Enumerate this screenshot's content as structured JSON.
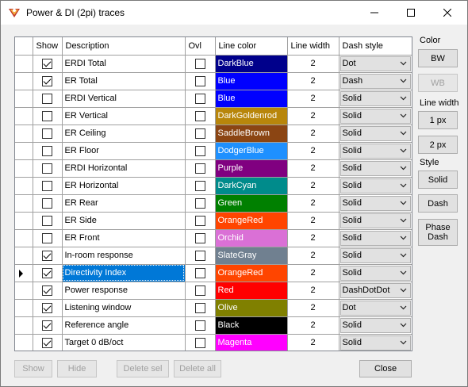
{
  "window": {
    "title": "Power & DI (2pi) traces"
  },
  "columns": {
    "show": "Show",
    "description": "Description",
    "ovl": "Ovl",
    "line_color": "Line color",
    "line_width": "Line width",
    "dash_style": "Dash style"
  },
  "rows": [
    {
      "show": true,
      "description": "ERDI Total",
      "ovl": false,
      "color_name": "DarkBlue",
      "color_hex": "#00008b",
      "width": "2",
      "dash": "Dot"
    },
    {
      "show": true,
      "description": "ER Total",
      "ovl": false,
      "color_name": "Blue",
      "color_hex": "#0000ff",
      "width": "2",
      "dash": "Dash"
    },
    {
      "show": false,
      "description": "ERDI Vertical",
      "ovl": false,
      "color_name": "Blue",
      "color_hex": "#0000ff",
      "width": "2",
      "dash": "Solid"
    },
    {
      "show": false,
      "description": "ER Vertical",
      "ovl": false,
      "color_name": "DarkGoldenrod",
      "color_hex": "#b8860b",
      "width": "2",
      "dash": "Solid"
    },
    {
      "show": false,
      "description": "ER Ceiling",
      "ovl": false,
      "color_name": "SaddleBrown",
      "color_hex": "#8b4513",
      "width": "2",
      "dash": "Solid"
    },
    {
      "show": false,
      "description": "ER Floor",
      "ovl": false,
      "color_name": "DodgerBlue",
      "color_hex": "#1e90ff",
      "width": "2",
      "dash": "Solid"
    },
    {
      "show": false,
      "description": "ERDI Horizontal",
      "ovl": false,
      "color_name": "Purple",
      "color_hex": "#800080",
      "width": "2",
      "dash": "Solid"
    },
    {
      "show": false,
      "description": "ER Horizontal",
      "ovl": false,
      "color_name": "DarkCyan",
      "color_hex": "#008b8b",
      "width": "2",
      "dash": "Solid"
    },
    {
      "show": false,
      "description": "ER Rear",
      "ovl": false,
      "color_name": "Green",
      "color_hex": "#008000",
      "width": "2",
      "dash": "Solid"
    },
    {
      "show": false,
      "description": "ER Side",
      "ovl": false,
      "color_name": "OrangeRed",
      "color_hex": "#ff4500",
      "width": "2",
      "dash": "Solid"
    },
    {
      "show": false,
      "description": "ER Front",
      "ovl": false,
      "color_name": "Orchid",
      "color_hex": "#da70d6",
      "width": "2",
      "dash": "Solid"
    },
    {
      "show": true,
      "description": "In-room response",
      "ovl": false,
      "color_name": "SlateGray",
      "color_hex": "#708090",
      "width": "2",
      "dash": "Solid"
    },
    {
      "show": true,
      "description": "Directivity Index",
      "ovl": false,
      "color_name": "OrangeRed",
      "color_hex": "#ff4500",
      "width": "2",
      "dash": "Solid",
      "selected": true
    },
    {
      "show": true,
      "description": "Power response",
      "ovl": false,
      "color_name": "Red",
      "color_hex": "#ff0000",
      "width": "2",
      "dash": "DashDotDot"
    },
    {
      "show": true,
      "description": "Listening window",
      "ovl": false,
      "color_name": "Olive",
      "color_hex": "#808000",
      "width": "2",
      "dash": "Dot"
    },
    {
      "show": true,
      "description": "Reference angle",
      "ovl": false,
      "color_name": "Black",
      "color_hex": "#000000",
      "width": "2",
      "dash": "Solid"
    },
    {
      "show": true,
      "description": "Target 0 dB/oct",
      "ovl": false,
      "color_name": "Magenta",
      "color_hex": "#ff00ff",
      "width": "2",
      "dash": "Solid"
    }
  ],
  "side": {
    "color_label": "Color",
    "bw": "BW",
    "wb": "WB",
    "line_width_label": "Line width",
    "one_px": "1 px",
    "two_px": "2 px",
    "style_label": "Style",
    "solid": "Solid",
    "dash": "Dash",
    "phase_dash_1": "Phase",
    "phase_dash_2": "Dash"
  },
  "bottom": {
    "show": "Show",
    "hide": "Hide",
    "delete_sel": "Delete sel",
    "delete_all": "Delete all",
    "close": "Close"
  }
}
